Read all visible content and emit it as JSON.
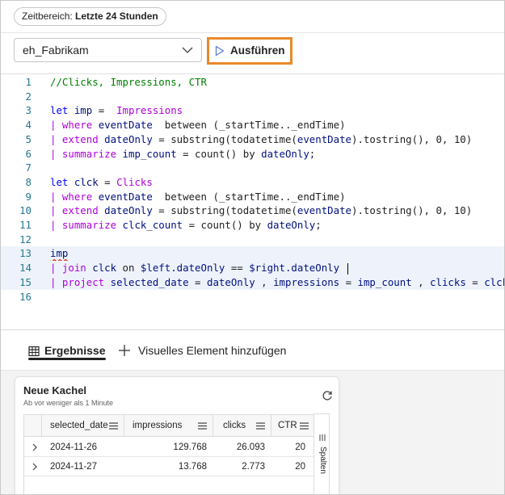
{
  "time_range": {
    "label": "Zeitbereich: ",
    "value": "Letzte 24 Stunden"
  },
  "toolbar": {
    "database": "eh_Fabrikam",
    "run_label": "Ausführen"
  },
  "editor": {
    "line_numbers": [
      "1",
      "2",
      "3",
      "4",
      "5",
      "6",
      "7",
      "8",
      "9",
      "10",
      "11",
      "12",
      "13",
      "14",
      "15",
      "16"
    ],
    "lines": [
      [
        {
          "t": "//Clicks, Impressions, CTR",
          "c": "c-cmt"
        }
      ],
      [],
      [
        {
          "t": "let ",
          "c": "c-kw"
        },
        {
          "t": "imp",
          "c": "c-id"
        },
        {
          "t": " =  ",
          "c": "c-plain"
        },
        {
          "t": "Impressions",
          "c": "c-op"
        }
      ],
      [
        {
          "t": "| ",
          "c": "c-pipe"
        },
        {
          "t": "where ",
          "c": "c-pipe"
        },
        {
          "t": "eventDate",
          "c": "c-id"
        },
        {
          "t": "  between ",
          "c": "c-plain"
        },
        {
          "t": "(_startTime.._endTime)",
          "c": "c-plain"
        }
      ],
      [
        {
          "t": "| ",
          "c": "c-pipe"
        },
        {
          "t": "extend ",
          "c": "c-pipe"
        },
        {
          "t": "dateOnly",
          "c": "c-id"
        },
        {
          "t": " = substring(todatetime(",
          "c": "c-plain"
        },
        {
          "t": "eventDate",
          "c": "c-id"
        },
        {
          "t": ").tostring(), 0, 10)",
          "c": "c-plain"
        }
      ],
      [
        {
          "t": "| ",
          "c": "c-pipe"
        },
        {
          "t": "summarize ",
          "c": "c-pipe"
        },
        {
          "t": "imp_count",
          "c": "c-id"
        },
        {
          "t": " = count() by ",
          "c": "c-plain"
        },
        {
          "t": "dateOnly",
          "c": "c-id"
        },
        {
          "t": ";",
          "c": "c-plain"
        }
      ],
      [],
      [
        {
          "t": "let ",
          "c": "c-kw"
        },
        {
          "t": "clck",
          "c": "c-id"
        },
        {
          "t": " = ",
          "c": "c-plain"
        },
        {
          "t": "Clicks",
          "c": "c-op"
        }
      ],
      [
        {
          "t": "| ",
          "c": "c-pipe"
        },
        {
          "t": "where ",
          "c": "c-pipe"
        },
        {
          "t": "eventDate",
          "c": "c-id"
        },
        {
          "t": "  between ",
          "c": "c-plain"
        },
        {
          "t": "(_startTime.._endTime)",
          "c": "c-plain"
        }
      ],
      [
        {
          "t": "| ",
          "c": "c-pipe"
        },
        {
          "t": "extend ",
          "c": "c-pipe"
        },
        {
          "t": "dateOnly",
          "c": "c-id"
        },
        {
          "t": " = substring(todatetime(",
          "c": "c-plain"
        },
        {
          "t": "eventDate",
          "c": "c-id"
        },
        {
          "t": ").tostring(), 0, 10)",
          "c": "c-plain"
        }
      ],
      [
        {
          "t": "| ",
          "c": "c-pipe"
        },
        {
          "t": "summarize ",
          "c": "c-pipe"
        },
        {
          "t": "clck_count",
          "c": "c-id"
        },
        {
          "t": " = count() by ",
          "c": "c-plain"
        },
        {
          "t": "dateOnly",
          "c": "c-id"
        },
        {
          "t": ";",
          "c": "c-plain"
        }
      ],
      [],
      [
        {
          "t": "imp",
          "c": "c-id squig"
        }
      ],
      [
        {
          "t": "| ",
          "c": "c-pipe"
        },
        {
          "t": "join ",
          "c": "c-pipe"
        },
        {
          "t": "clck",
          "c": "c-id"
        },
        {
          "t": " on ",
          "c": "c-plain"
        },
        {
          "t": "$left.dateOnly",
          "c": "c-id"
        },
        {
          "t": " == ",
          "c": "c-plain"
        },
        {
          "t": "$right.dateOnly",
          "c": "c-id"
        },
        {
          "t": " ",
          "c": "c-plain"
        }
      ],
      [
        {
          "t": "| ",
          "c": "c-pipe"
        },
        {
          "t": "project ",
          "c": "c-pipe"
        },
        {
          "t": "selected_date",
          "c": "c-id"
        },
        {
          "t": " = ",
          "c": "c-plain"
        },
        {
          "t": "dateOnly",
          "c": "c-id"
        },
        {
          "t": " , ",
          "c": "c-plain"
        },
        {
          "t": "impressions",
          "c": "c-id"
        },
        {
          "t": " = ",
          "c": "c-plain"
        },
        {
          "t": "imp_count",
          "c": "c-id"
        },
        {
          "t": " , ",
          "c": "c-plain"
        },
        {
          "t": "clicks",
          "c": "c-id"
        },
        {
          "t": " = ",
          "c": "c-plain"
        },
        {
          "t": "clck_c",
          "c": "c-id"
        }
      ],
      []
    ]
  },
  "results": {
    "tab_results": "Ergebnisse",
    "tab_add_visual": "Visuelles Element hinzufügen"
  },
  "tile": {
    "title": "Neue Kachel",
    "subtitle": "Ab vor weniger als 1 Minute",
    "columns": [
      "selected_date",
      "impressions",
      "clicks",
      "CTR"
    ],
    "rows": [
      [
        "2024-11-26",
        "129.768",
        "26.093",
        "20"
      ],
      [
        "2024-11-27",
        "13.768",
        "2.773",
        "20"
      ]
    ],
    "columns_panel_label": "Spalten"
  },
  "colors": {
    "accent_outline": "#e8892a",
    "play_icon": "#5b7fd6"
  }
}
